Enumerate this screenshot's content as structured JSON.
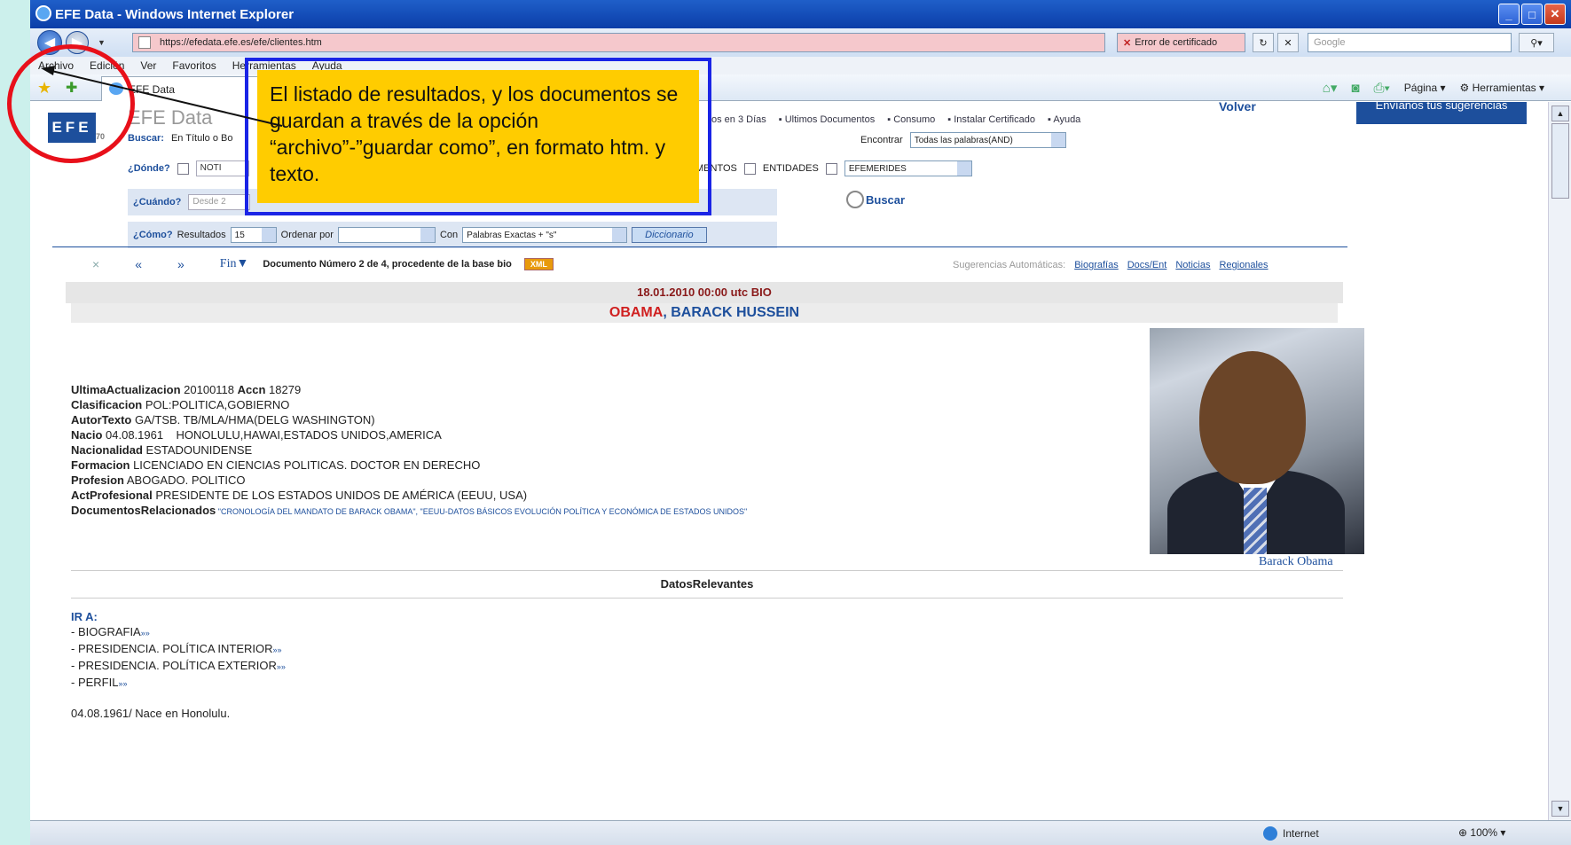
{
  "window": {
    "title": "EFE Data - Windows Internet Explorer"
  },
  "address": {
    "url": "https://efedata.efe.es/efe/clientes.htm",
    "cert_error": "Error de certificado",
    "search_placeholder": "Google"
  },
  "menu": [
    "Archivo",
    "Edición",
    "Ver",
    "Favoritos",
    "Herramientas",
    "Ayuda"
  ],
  "tab": {
    "label": "EFE Data"
  },
  "cmd": {
    "page": "Página",
    "tools": "Herramientas"
  },
  "site": {
    "logo": "EFE",
    "logo_sub": "70",
    "title": "EFE Data",
    "nav": [
      "os en 3 Días",
      "Ultimos Documentos",
      "Consumo",
      "Instalar Certificado",
      "Ayuda"
    ],
    "volver": "Volver",
    "sugerencias": "Envíanos tus sugerencias"
  },
  "search": {
    "buscar_label": "Buscar:",
    "buscar_scope": "En Título o Bo",
    "encontrar_label": "Encontrar",
    "encontrar_value": "Todas las palabras(AND)",
    "donde_label": "¿Dónde?",
    "donde_opt1": "NOTI",
    "donde_opt2": "MENTOS",
    "donde_opt3": "ENTIDADES",
    "donde_select": "EFEMERIDES",
    "cuando_label": "¿Cuándo?",
    "cuando_desde": "Desde 2",
    "buscar_button": "Buscar",
    "como_label": "¿Cómo?",
    "resultados_label": "Resultados",
    "resultados_value": "15",
    "ordenar_label": "Ordenar por",
    "ordenar_value": "",
    "con_label": "Con",
    "con_value": "Palabras Exactas + \"s\"",
    "diccionario": "Diccionario"
  },
  "docnav": {
    "close": "×",
    "prev": "«",
    "next": "»",
    "fin": "Fin▼",
    "doc_info": "Documento Número 2 de 4, procedente de la base bio",
    "xml": "XML",
    "sug_label": "Sugerencias Automáticas:",
    "sug_links": [
      "Biografías",
      "Docs/Ent",
      "Noticias",
      "Regionales"
    ]
  },
  "doc": {
    "date": "18.01.2010  00:00 utc   BIO",
    "surname": "OBAMA",
    "given": ", BARACK HUSSEIN",
    "caption": "Barack Obama",
    "fields": [
      {
        "k": "UltimaActualizacion",
        "v": " 20100118 ",
        "k2": "Accn",
        "v2": " 18279"
      },
      {
        "k": "Clasificacion",
        "v": " POL:POLITICA,GOBIERNO"
      },
      {
        "k": "AutorTexto",
        "v": " GA/TSB. TB/MLA/HMA(DELG WASHINGTON)"
      },
      {
        "k": "Nacio",
        "v": " 04.08.1961    HONOLULU,HAWAI,ESTADOS UNIDOS,AMERICA"
      },
      {
        "k": "Nacionalidad",
        "v": " ESTADOUNIDENSE"
      },
      {
        "k": "Formacion",
        "v": " LICENCIADO EN CIENCIAS POLITICAS. DOCTOR EN DERECHO"
      },
      {
        "k": "Profesion",
        "v": " ABOGADO. POLITICO"
      },
      {
        "k": "ActProfesional",
        "v": " PRESIDENTE DE LOS ESTADOS UNIDOS DE AMÉRICA (EEUU, USA)"
      }
    ],
    "docs_rel_label": "DocumentosRelacionados",
    "docs_rel_value": " \"CRONOLOGÍA DEL MANDATO DE BARACK OBAMA\", \"EEUU-DATOS BÁSICOS EVOLUCIÓN POLÍTICA Y ECONÓMICA DE ESTADOS UNIDOS\"",
    "datos": "DatosRelevantes",
    "ira_label": "IR A:",
    "ira_items": [
      "- BIOGRAFIA",
      "- PRESIDENCIA. POLÍTICA INTERIOR",
      "- PRESIDENCIA. POLÍTICA EXTERIOR",
      "- PERFIL"
    ],
    "ira_link": "»»",
    "fecha": "04.08.1961/ Nace en Honolulu."
  },
  "status": {
    "zone": "Internet",
    "zoom": "100%"
  },
  "callout": {
    "text": "El listado de resultados, y los documentos se guardan a través de la opción “archivo”-”guardar como”, en formato htm. y texto."
  },
  "colors": {
    "callout_bg": "#ffcc00",
    "callout_border": "#1a24e6",
    "circle": "#e8101a",
    "brand": "#1d4f9c"
  }
}
